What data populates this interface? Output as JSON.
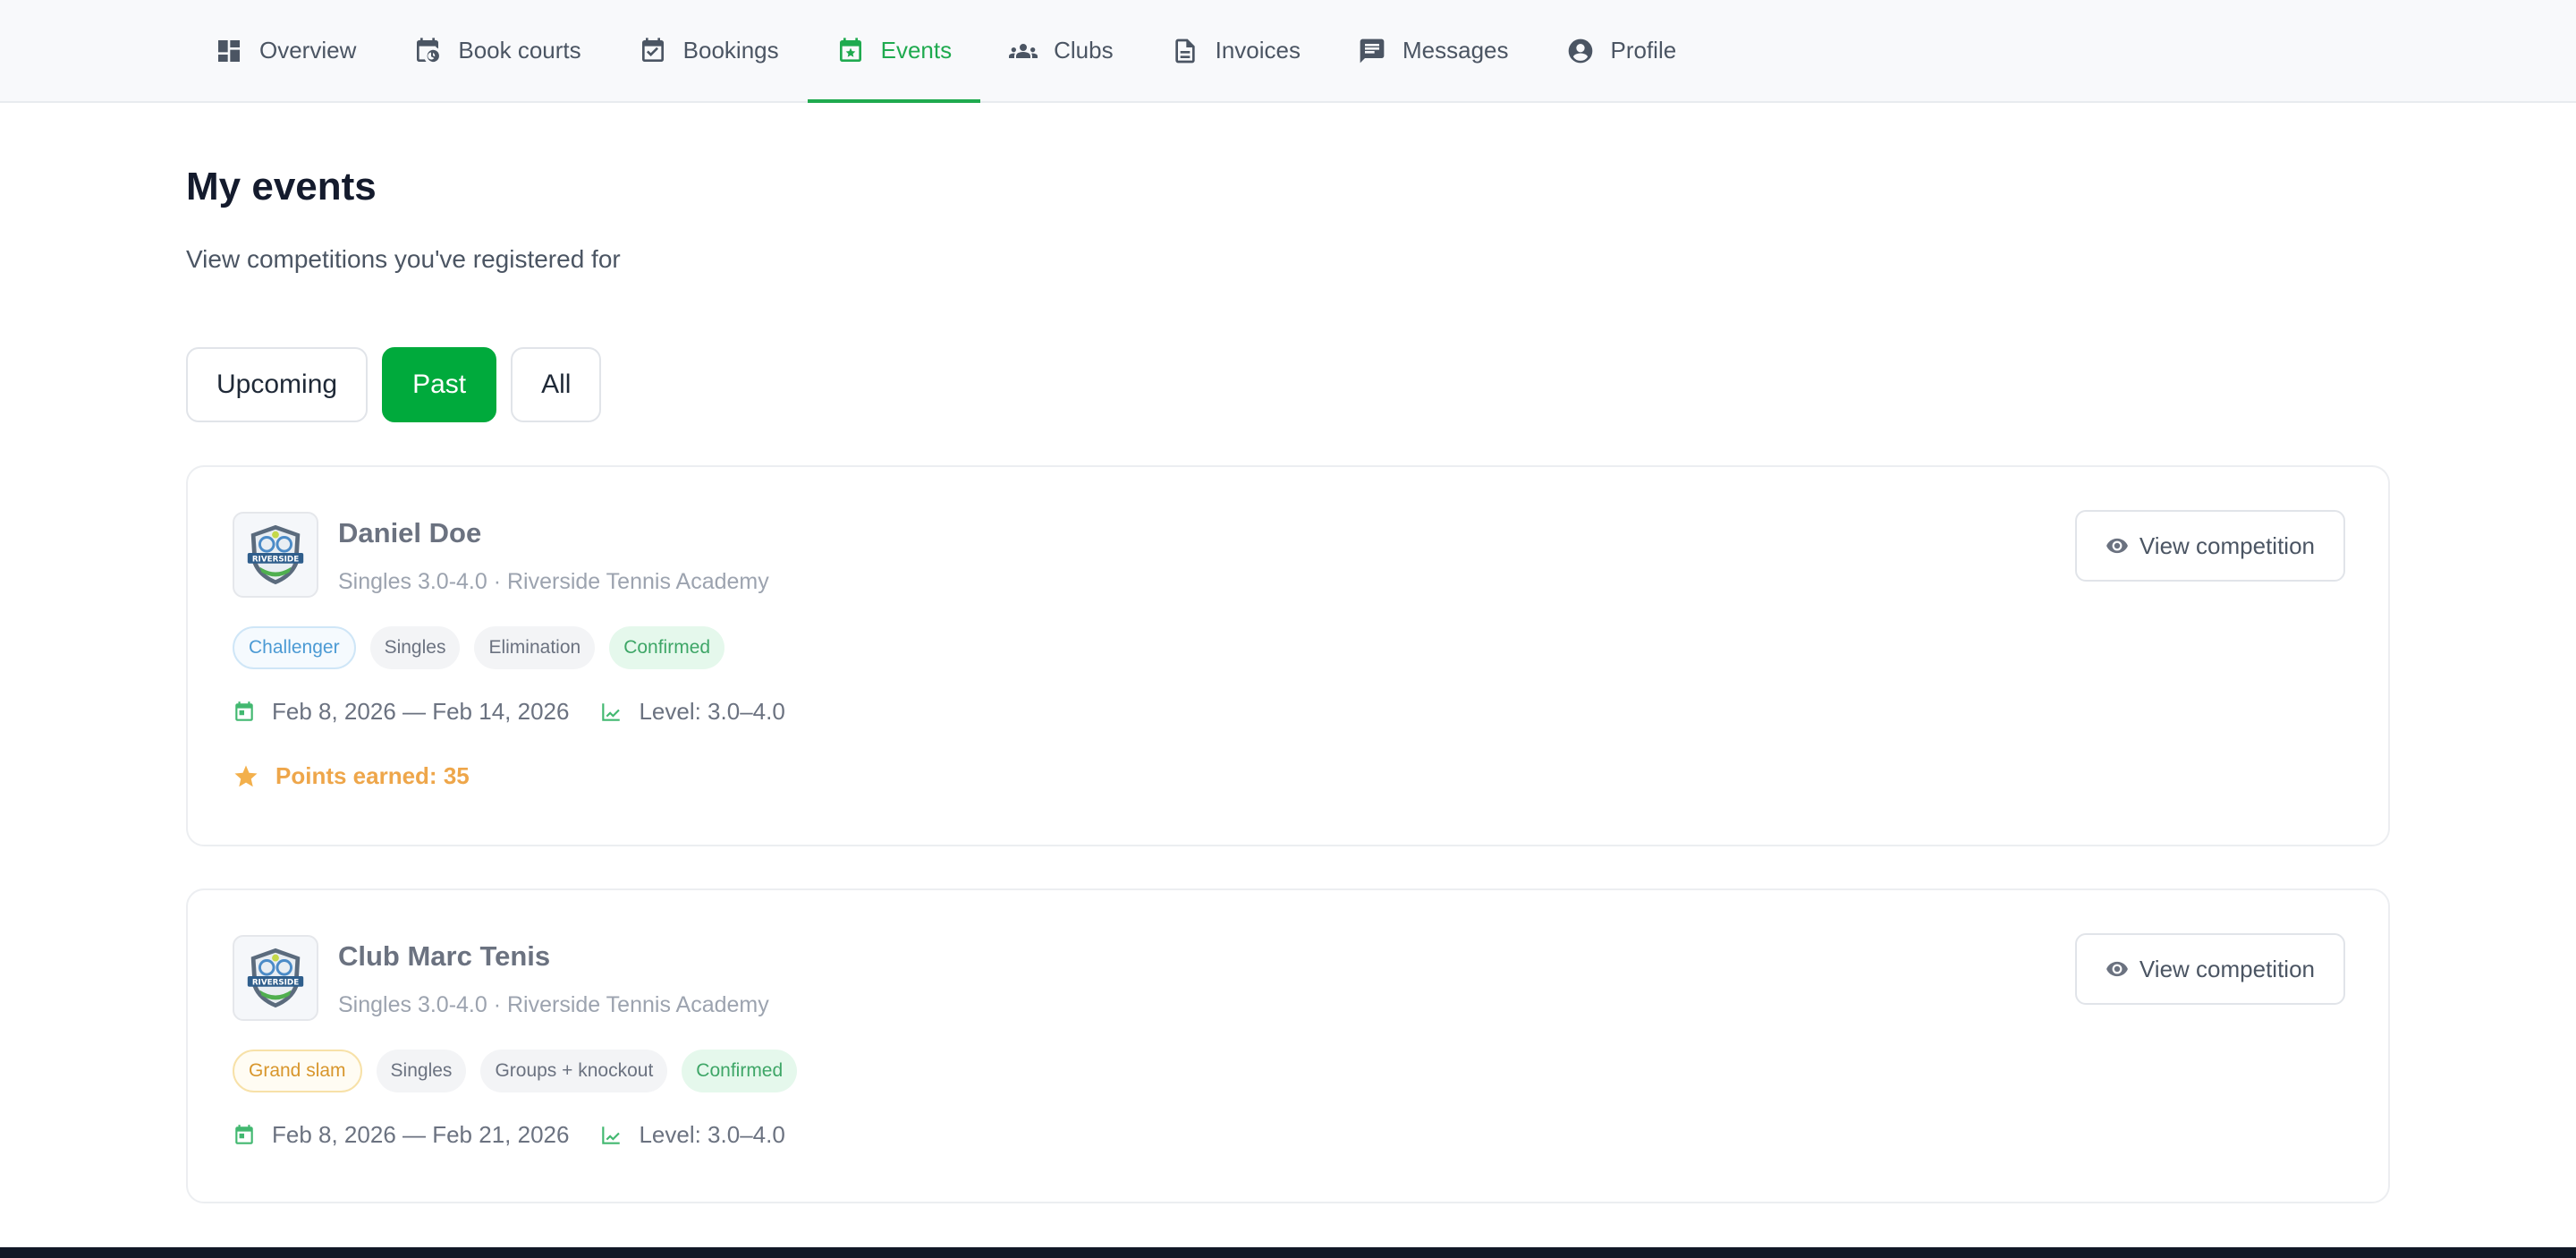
{
  "nav": {
    "items": [
      {
        "label": "Overview",
        "icon": "dashboard-icon",
        "active": false
      },
      {
        "label": "Book courts",
        "icon": "calendar-clock-icon",
        "active": false
      },
      {
        "label": "Bookings",
        "icon": "calendar-check-icon",
        "active": false
      },
      {
        "label": "Events",
        "icon": "calendar-star-icon",
        "active": true
      },
      {
        "label": "Clubs",
        "icon": "people-icon",
        "active": false
      },
      {
        "label": "Invoices",
        "icon": "document-icon",
        "active": false
      },
      {
        "label": "Messages",
        "icon": "chat-icon",
        "active": false
      },
      {
        "label": "Profile",
        "icon": "account-circle-icon",
        "active": false
      }
    ]
  },
  "header": {
    "title": "My events",
    "subtitle": "View competitions you've registered for"
  },
  "filters": {
    "items": [
      "Upcoming",
      "Past",
      "All"
    ],
    "selected": "Past"
  },
  "events": [
    {
      "name": "Daniel Doe",
      "subtitle": "Singles 3.0-4.0 · Riverside Tennis Academy",
      "logo_text": "RIVERSIDE",
      "tags": [
        "Challenger",
        "Singles",
        "Elimination",
        "Confirmed"
      ],
      "dates": "Feb 8, 2026 — Feb 14, 2026",
      "level": "Level: 3.0–4.0",
      "points": "Points earned: 35",
      "action": "View competition"
    },
    {
      "name": "Club Marc Tenis",
      "subtitle": "Singles 3.0-4.0 · Riverside Tennis Academy",
      "logo_text": "RIVERSIDE",
      "tags": [
        "Grand slam",
        "Singles",
        "Groups + knockout",
        "Confirmed"
      ],
      "dates": "Feb 8, 2026 — Feb 21, 2026",
      "level": "Level: 3.0–4.0",
      "action": "View competition"
    }
  ],
  "colors": {
    "accent": "#1faa4f",
    "primary_button": "#00aa3c",
    "points": "#eea64a",
    "tag_blue": "#4b9ad4",
    "tag_yellow": "#d8962c",
    "tag_green": "#3ea667"
  }
}
